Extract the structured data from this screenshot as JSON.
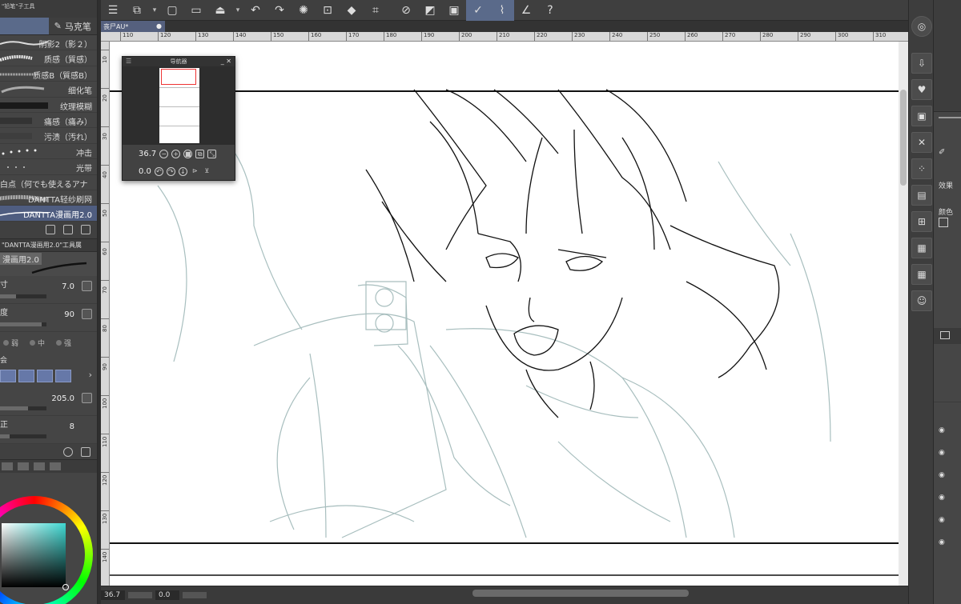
{
  "left_panel": {
    "header": "\"铅笔\"子工具",
    "tabs": [
      {
        "label": "马克笔",
        "active": true
      }
    ],
    "brushes": [
      {
        "label": "阴影2（影２）"
      },
      {
        "label": "质感（質感）"
      },
      {
        "label": "质感B（質感B）"
      },
      {
        "label": "细化笔"
      },
      {
        "label": "纹理模糊"
      },
      {
        "label": "痛感（痛み）"
      },
      {
        "label": "污渍（汚れ）"
      },
      {
        "label": "冲击"
      },
      {
        "label": "光带"
      },
      {
        "label": "白点（何でも使えるアナ"
      },
      {
        "label": "DANTTA轻纱刷网"
      },
      {
        "label": "DANTTA漫画用2.0",
        "selected": true
      }
    ],
    "sub_tool_detail_header": "\"DANTTA漫画用2.0\"工具属",
    "sub_tool_name": "漫画用2.0",
    "properties": [
      {
        "label": "寸",
        "value": "7.0",
        "fill": 0.35
      },
      {
        "label": "度",
        "value": "90",
        "fill": 0.9
      },
      {
        "label": "会",
        "value": ""
      },
      {
        "label": "",
        "value": "205.0",
        "fill": 0.6
      },
      {
        "label": "正",
        "value": "8",
        "fill": 0.2
      }
    ],
    "antialias": [
      "弱",
      "中",
      "强"
    ]
  },
  "toolbar": {
    "icons": [
      "menu-icon",
      "new-layer-icon",
      "new-canvas-icon",
      "open-icon",
      "save-icon",
      "undo-icon",
      "redo-icon",
      "loading-icon",
      "clear-icon",
      "fill-icon",
      "transform-icon",
      "deselect-icon",
      "invert-icon",
      "selection-border-icon",
      "pen-icon",
      "brush-icon",
      "eraser-icon",
      "help-icon"
    ]
  },
  "document": {
    "tab_label": "丧尸AU*",
    "modified_dot": "●"
  },
  "ruler": {
    "h_ticks": [
      "110",
      "120",
      "130",
      "140",
      "150",
      "160",
      "170",
      "180",
      "190",
      "200",
      "210",
      "220",
      "230",
      "240",
      "250",
      "260",
      "270",
      "280",
      "290",
      "300",
      "310"
    ],
    "v_ticks": [
      "10",
      "20",
      "30",
      "40",
      "50",
      "60",
      "70",
      "80",
      "90",
      "100",
      "110",
      "120",
      "130",
      "140"
    ]
  },
  "navigator": {
    "title": "导航器",
    "zoom": "36.7",
    "rotation": "0.0"
  },
  "status_bar": {
    "zoom": "36.7",
    "rotation": "0.0"
  },
  "right_panel": {
    "labels": [
      "效果",
      "颜色"
    ],
    "layer_visible_icons": 6
  },
  "colors": {
    "accent": "#5a6a8a",
    "sketch": "#9fb8b8",
    "ink": "#111111",
    "current_color": "#3fd8d2"
  }
}
